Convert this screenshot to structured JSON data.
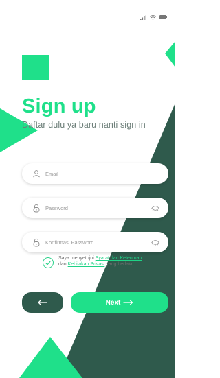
{
  "colors": {
    "accent": "#1fe08a",
    "dark_green": "#2f5a4c",
    "text_muted": "#6d7f79"
  },
  "header": {
    "title": "Sign up",
    "subtitle": "Daftar dulu ya baru nanti sign in"
  },
  "form": {
    "email": {
      "placeholder": "Email",
      "icon": "user-icon"
    },
    "password": {
      "placeholder": "Password",
      "icon": "lock-icon",
      "toggle_icon": "eye-icon"
    },
    "confirm_password": {
      "placeholder": "Konfirmasi Password",
      "icon": "lock-icon",
      "toggle_icon": "eye-icon"
    }
  },
  "terms": {
    "checked": true,
    "prefix": "Saya menyetujui ",
    "link1": "Syarat dan Ketentuan",
    "middle": "dan ",
    "link2": "Kebijakan Privasi",
    "suffix": " yang berlaku."
  },
  "buttons": {
    "back_icon": "arrow-left-icon",
    "next_label": "Next",
    "next_icon": "arrow-right-icon"
  },
  "status_bar": {
    "icons": [
      "signal-icon",
      "wifi-icon",
      "battery-icon"
    ]
  }
}
